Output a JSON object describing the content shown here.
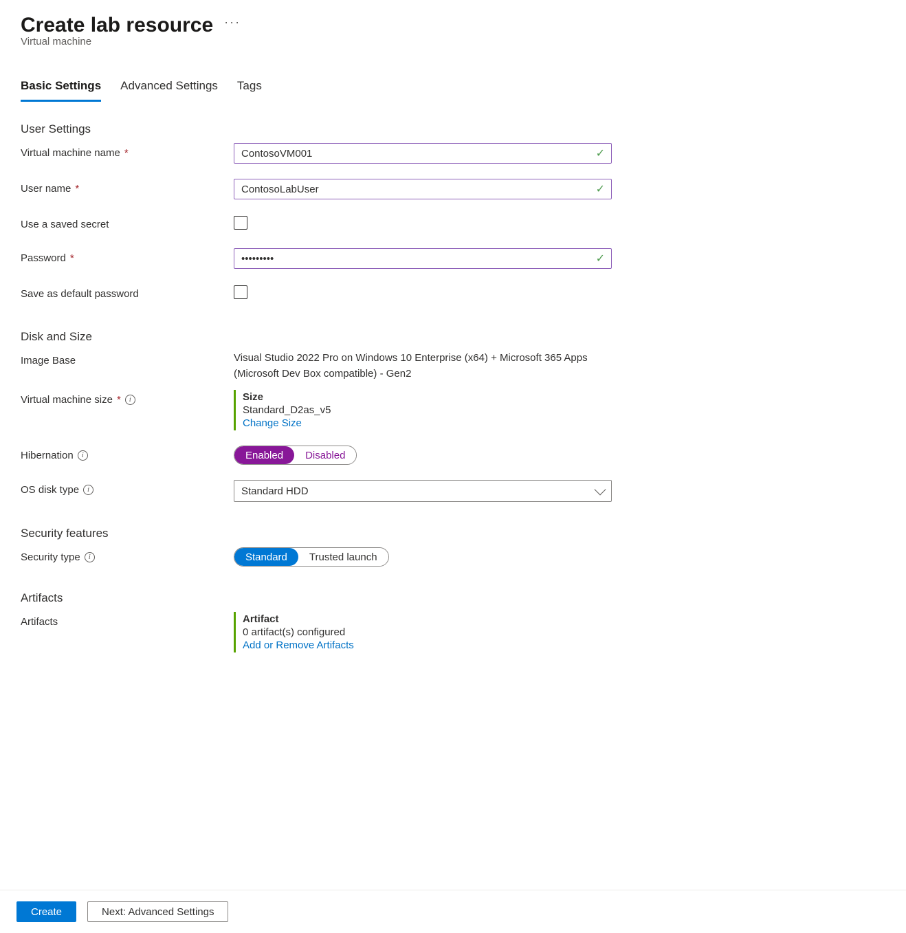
{
  "header": {
    "title": "Create lab resource",
    "subtitle": "Virtual machine"
  },
  "tabs": {
    "basic": "Basic Settings",
    "advanced": "Advanced Settings",
    "tags": "Tags"
  },
  "sections": {
    "user_settings": "User Settings",
    "disk_size": "Disk and Size",
    "security": "Security features",
    "artifacts": "Artifacts"
  },
  "labels": {
    "vm_name": "Virtual machine name",
    "user_name": "User name",
    "use_saved_secret": "Use a saved secret",
    "password": "Password",
    "save_default_pw": "Save as default password",
    "image_base": "Image Base",
    "vm_size": "Virtual machine size",
    "hibernation": "Hibernation",
    "os_disk_type": "OS disk type",
    "security_type": "Security type",
    "artifacts": "Artifacts"
  },
  "values": {
    "vm_name": "ContosoVM001",
    "user_name": "ContosoLabUser",
    "password": "•••••••••",
    "image_base": "Visual Studio 2022 Pro on Windows 10 Enterprise (x64) + Microsoft 365 Apps (Microsoft Dev Box compatible) - Gen2",
    "os_disk_type": "Standard HDD"
  },
  "size_card": {
    "title": "Size",
    "value": "Standard_D2as_v5",
    "link": "Change Size"
  },
  "hibernation_options": {
    "enabled": "Enabled",
    "disabled": "Disabled"
  },
  "security_options": {
    "standard": "Standard",
    "trusted": "Trusted launch"
  },
  "artifact_card": {
    "title": "Artifact",
    "value": "0 artifact(s) configured",
    "link": "Add or Remove Artifacts"
  },
  "footer": {
    "create": "Create",
    "next": "Next: Advanced Settings"
  }
}
